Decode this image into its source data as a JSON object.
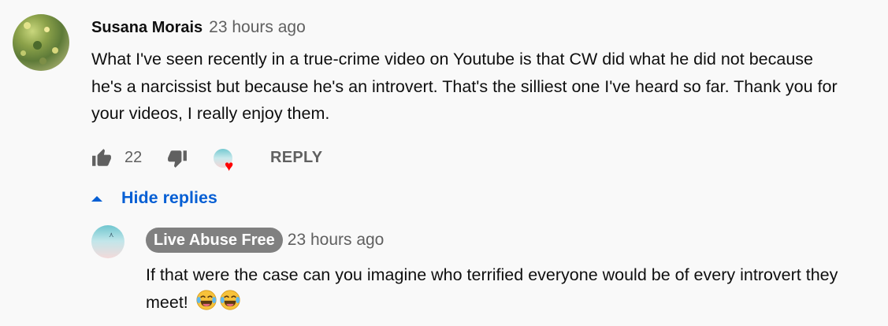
{
  "comment": {
    "author": "Susana Morais",
    "time": "23 hours ago",
    "text": "What I've seen recently in a true-crime video on Youtube is that CW did what he did not because he's a narcissist but because he's an introvert. That's the silliest one I've heard so far. Thank you for your videos, I really enjoy them.",
    "likes": "22",
    "reply_label": "REPLY",
    "creator_heart": true,
    "icons": [
      "thumbs-up-icon",
      "thumbs-down-icon",
      "creator-heart-icon"
    ]
  },
  "replies_toggle": {
    "label": "Hide replies",
    "icon": "caret-up-icon"
  },
  "reply": {
    "author": "Live Abuse Free",
    "time": "23 hours ago",
    "text": "If that were the case can you imagine who terrified everyone would be of every introvert they meet!",
    "emojis": [
      "face-with-tears-of-joy-icon",
      "face-with-tears-of-joy-icon"
    ]
  },
  "colors": {
    "background": "#f9f9f9",
    "link_blue": "#065fd4",
    "secondary_text": "#606060",
    "heart_red": "#ff0000",
    "creator_chip": "#808080"
  }
}
